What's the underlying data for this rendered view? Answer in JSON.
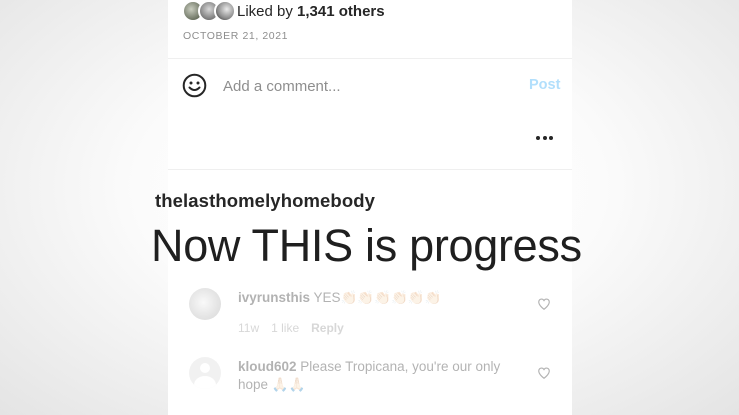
{
  "post": {
    "likes_prefix": "Liked by ",
    "likes_count": "1,341 others",
    "date": "OCTOBER 21, 2021"
  },
  "comment_box": {
    "placeholder": "Add a comment...",
    "post_label": "Post"
  },
  "caption": {
    "username": "thelasthomelyhomebody",
    "text": "Now THIS is progress"
  },
  "comments": [
    {
      "username": "ivyrunsthis",
      "text": "YES👏🏻👏🏻👏🏻👏🏻👏🏻👏🏻",
      "time": "11w",
      "likes": "1 like",
      "reply": "Reply"
    },
    {
      "username": "kloud602",
      "text": "Please Tropicana, you're our only hope 🙏🏻🙏🏻"
    }
  ],
  "colors": {
    "post_button": "#b2dffc",
    "muted_text": "#8e8e8e",
    "primary_text": "#262626"
  },
  "icons": [
    "smiley-icon",
    "more-options-icon",
    "heart-icon",
    "default-avatar-icon"
  ]
}
